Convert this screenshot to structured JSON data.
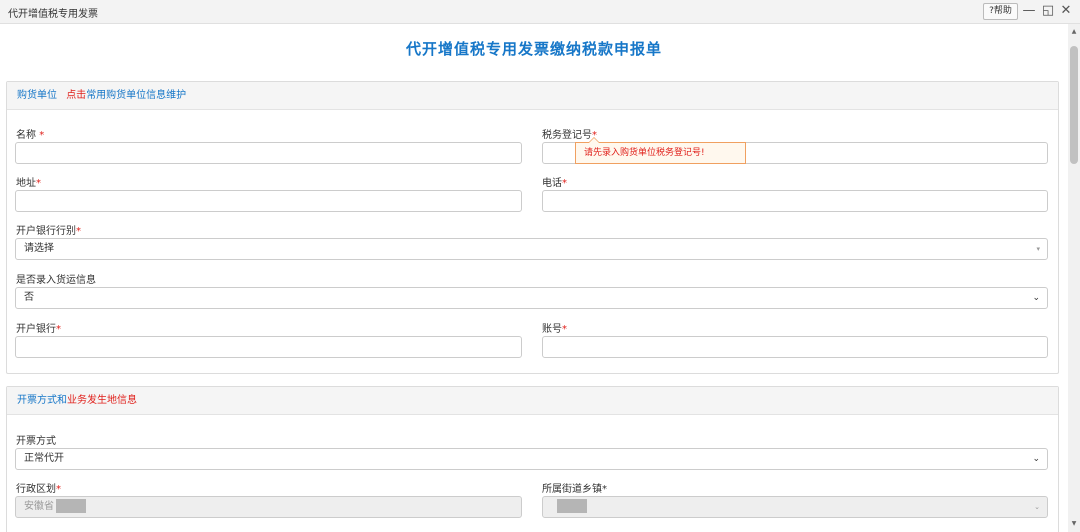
{
  "window": {
    "title": "代开增值税专用发票",
    "help_label": "?帮助",
    "minimize_icon": "—",
    "restore_icon": "◱",
    "close_icon": "✕"
  },
  "page_title": "代开增值税专用发票缴纳税款申报单",
  "section1": {
    "head_label": "购货单位",
    "head_link_red": "点击",
    "head_link_blue": "常用购货单位信息维护",
    "name_label": "名称",
    "taxid_label": "税务登记号",
    "address_label": "地址",
    "phone_label": "电话",
    "bank_type_label": "开户银行行别",
    "bank_type_value": "请选择",
    "cargo_label": "是否录入货运信息",
    "cargo_value": "否",
    "bank_label": "开户银行",
    "account_label": "账号",
    "star": "*",
    "tooltip": "请先录入购货单位税务登记号!"
  },
  "section2": {
    "head_blue": "开票方式和",
    "head_red": "业务发生地信息",
    "invoice_method_label": "开票方式",
    "invoice_method_value": "正常代开",
    "district_label": "行政区划",
    "district_value": "安徽省",
    "street_label": "所属街道乡镇",
    "star": "*"
  },
  "icons": {
    "select_caret": "⌄",
    "small_caret": "▾",
    "scroll_up": "▲",
    "scroll_down": "▼"
  }
}
